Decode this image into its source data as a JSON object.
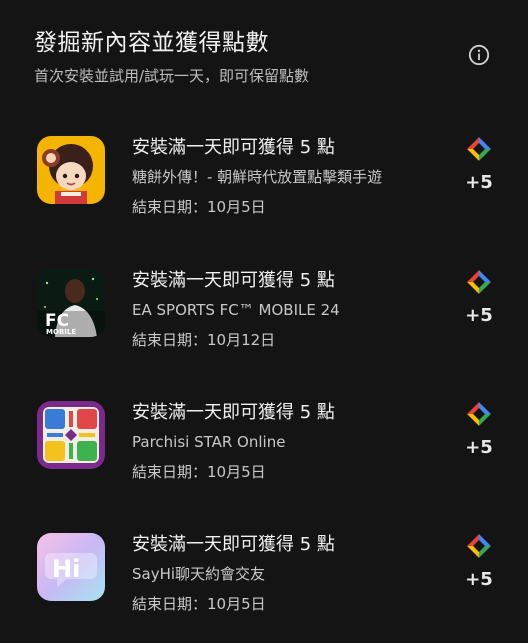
{
  "header": {
    "title": "發掘新內容並獲得點數",
    "subtitle": "首次安裝並試用/試玩一天，即可保留點數"
  },
  "offers": [
    {
      "title": "安裝滿一天即可獲得 5 點",
      "app_name": "糖餅外傳！- 朝鮮時代放置點擊類手遊",
      "end_date": "結束日期：10月5日",
      "points": "+5",
      "icon": "cartoon-girl-app-icon"
    },
    {
      "title": "安裝滿一天即可獲得 5 點",
      "app_name": "EA SPORTS FC™ MOBILE 24",
      "end_date": "結束日期：10月12日",
      "points": "+5",
      "icon": "ea-fc-mobile-app-icon",
      "icon_text": "FC",
      "icon_subtext": "MOBILE"
    },
    {
      "title": "安裝滿一天即可獲得 5 點",
      "app_name": "Parchisi STAR Online",
      "end_date": "結束日期：10月5日",
      "points": "+5",
      "icon": "parchisi-board-app-icon"
    },
    {
      "title": "安裝滿一天即可獲得 5 點",
      "app_name": "SayHi聊天約會交友",
      "end_date": "結束日期：10月5日",
      "points": "+5",
      "icon": "sayhi-app-icon",
      "icon_text": "Hi"
    }
  ],
  "colors": {
    "background": "#141414",
    "play_points_green": "#34a853",
    "play_points_blue": "#4285f4",
    "play_points_red": "#ea4335",
    "play_points_yellow": "#fbbc04"
  }
}
